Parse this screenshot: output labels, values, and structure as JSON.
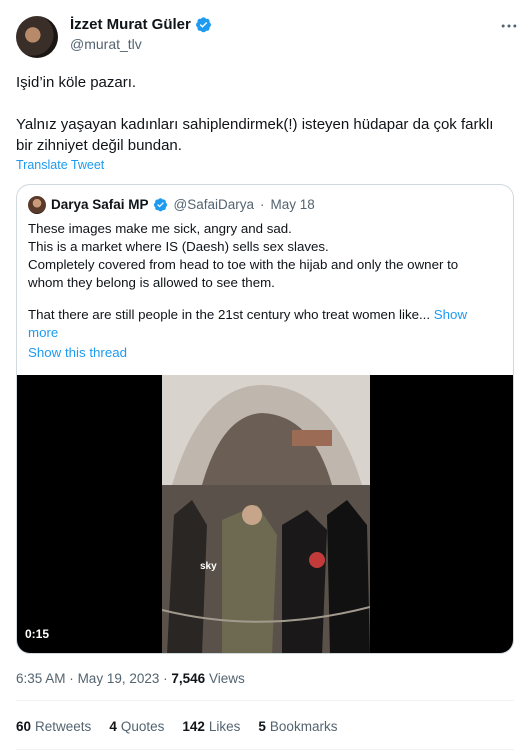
{
  "author": {
    "name": "İzzet Murat Güler",
    "handle": "@murat_tlv"
  },
  "tweet": {
    "line1": "Işid’in köle pazarı.",
    "line2": "Yalnız yaşayan kadınları sahiplendirmek(!) isteyen hüdapar da çok farklı",
    "line3": "bir zihniyet değil bundan.",
    "translate_label": "Translate Tweet"
  },
  "quoted": {
    "name": "Darya Safai MP",
    "handle": "@SafaiDarya",
    "separator": "·",
    "date": "May 18",
    "lines": [
      "These images make me sick, angry and sad.",
      "This is a market where IS (Daesh) sells sex slaves.",
      "Completely covered from head to toe with the hijab and only the owner to",
      "whom they belong is allowed to see them."
    ],
    "last_line": "That there are still people in the 21st century who treat women like...",
    "show_more_1": "Show",
    "show_more_2": "more",
    "show_thread": "Show this thread",
    "video_time": "0:15",
    "video_watermark": "sky"
  },
  "meta": {
    "time": "6:35 AM",
    "separator": "·",
    "date": "May 19, 2023",
    "views_count": "7,546",
    "views_label": "Views"
  },
  "stats": [
    {
      "count": "60",
      "label": "Retweets"
    },
    {
      "count": "4",
      "label": "Quotes"
    },
    {
      "count": "142",
      "label": "Likes"
    },
    {
      "count": "5",
      "label": "Bookmarks"
    }
  ],
  "colors": {
    "link": "#1d9bf0",
    "verified": "#1d9bf0",
    "muted": "#536471"
  },
  "icons": {
    "verified": "verified-badge-icon",
    "more": "more-options-icon"
  }
}
